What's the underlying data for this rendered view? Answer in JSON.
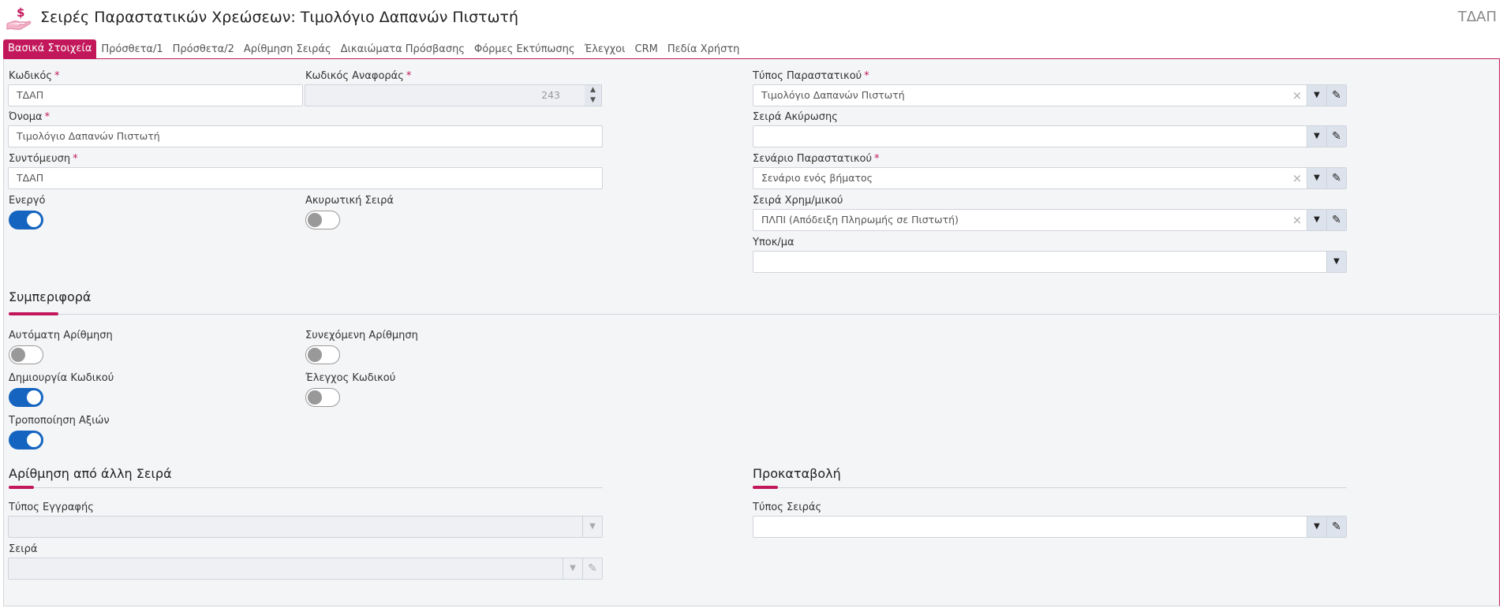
{
  "header": {
    "title": "Σειρές Παραστατικών Χρεώσεων: Τιμολόγιο Δαπανών Πιστωτή",
    "code": "ΤΔΑΠ",
    "logo_icon": "hand-dollar-icon"
  },
  "tabs": [
    {
      "label": "Βασικά Στοιχεία",
      "active": true
    },
    {
      "label": "Πρόσθετα/1"
    },
    {
      "label": "Πρόσθετα/2"
    },
    {
      "label": "Αρίθμηση Σειράς"
    },
    {
      "label": "Δικαιώματα Πρόσβασης"
    },
    {
      "label": "Φόρμες Εκτύπωσης"
    },
    {
      "label": "Έλεγχοι"
    },
    {
      "label": "CRM"
    },
    {
      "label": "Πεδία Χρήστη"
    }
  ],
  "fields": {
    "code": {
      "label": "Κωδικός",
      "required": "*",
      "value": "ΤΔΑΠ"
    },
    "ref_code": {
      "label": "Κωδικός Αναφοράς",
      "required": "*",
      "value": "243"
    },
    "name": {
      "label": "Όνομα",
      "required": "*",
      "value": "Τιμολόγιο Δαπανών Πιστωτή"
    },
    "short": {
      "label": "Συντόμευση",
      "required": "*",
      "value": "ΤΔΑΠ"
    },
    "active": {
      "label": "Ενεργό",
      "on": true
    },
    "cancel_series": {
      "label": "Ακυρωτική Σειρά",
      "on": false
    },
    "doc_type": {
      "label": "Τύπος Παραστατικού",
      "required": "*",
      "value": "Τιμολόγιο Δαπανών Πιστωτή"
    },
    "cancel_series_sel": {
      "label": "Σειρά Ακύρωσης",
      "value": ""
    },
    "scenario": {
      "label": "Σενάριο Παραστατικού",
      "required": "*",
      "value": "Σενάριο ενός βήματος"
    },
    "payment_series": {
      "label": "Σειρά Χρημ/μικού",
      "value": "ΠΛΠΙ (Απόδειξη Πληρωμής σε Πιστωτή)"
    },
    "branch": {
      "label": "Υποκ/μα",
      "value": ""
    }
  },
  "behavior": {
    "title": "Συμπεριφορά",
    "auto_numbering": {
      "label": "Αυτόματη Αρίθμηση",
      "on": false
    },
    "continuous_numbering": {
      "label": "Συνεχόμενη Αρίθμηση",
      "on": false
    },
    "code_create": {
      "label": "Δημιουργία Κωδικού",
      "on": true
    },
    "code_check": {
      "label": "Έλεγχος Κωδικού",
      "on": false
    },
    "value_edit": {
      "label": "Τροποποίηση Αξιών",
      "on": true
    }
  },
  "numbering_other": {
    "title": "Αρίθμηση από άλλη Σειρά",
    "record_type": {
      "label": "Τύπος Εγγραφής",
      "value": ""
    },
    "series": {
      "label": "Σειρά",
      "value": ""
    }
  },
  "advance": {
    "title": "Προκαταβολή",
    "series_type": {
      "label": "Τύπος Σειράς",
      "value": ""
    }
  },
  "icons": {
    "clear": "×",
    "dropdown": "▼",
    "edit": "✎",
    "spin_up": "▲",
    "spin_down": "▼"
  },
  "colors": {
    "accent": "#c2185b",
    "toggle_on": "#1565c0"
  }
}
